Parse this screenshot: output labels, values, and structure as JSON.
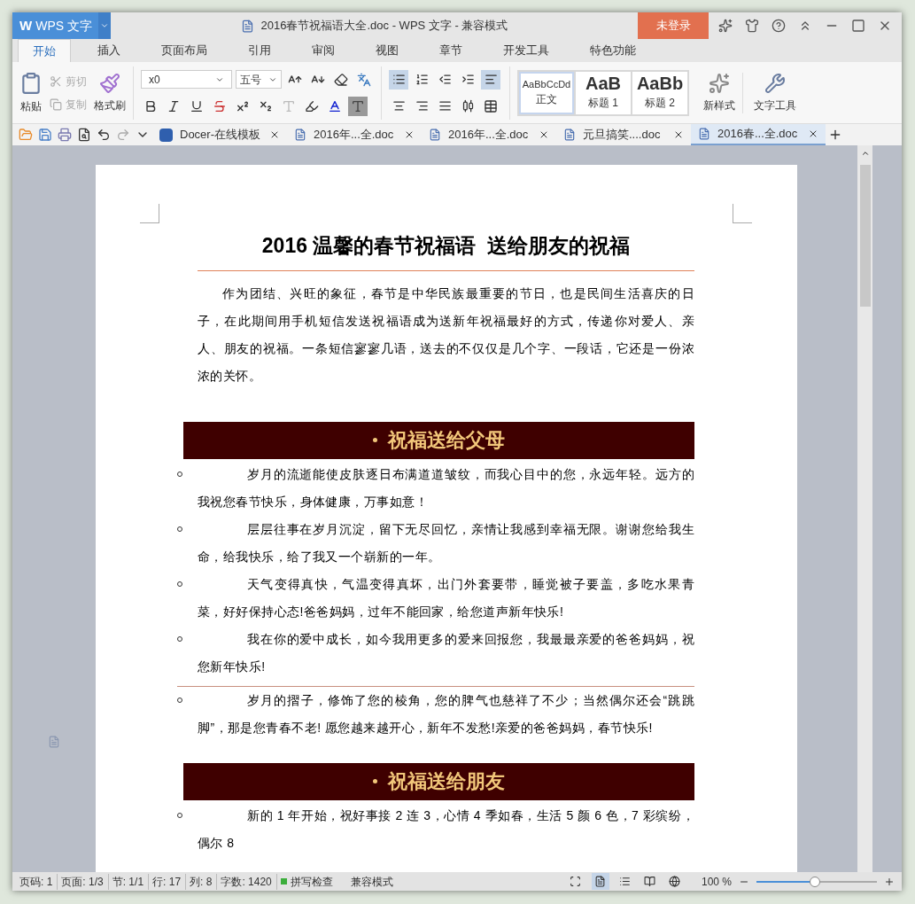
{
  "window": {
    "app_logo": "W",
    "app_button": "WPS 文字",
    "title": "2016春节祝福语大全.doc - WPS 文字 - 兼容模式",
    "login_button": "未登录"
  },
  "menu_tabs": [
    {
      "label": "开始",
      "selected": true
    },
    {
      "label": "插入",
      "selected": false
    },
    {
      "label": "页面布局",
      "selected": false
    },
    {
      "label": "引用",
      "selected": false
    },
    {
      "label": "审阅",
      "selected": false
    },
    {
      "label": "视图",
      "selected": false
    },
    {
      "label": "章节",
      "selected": false
    },
    {
      "label": "开发工具",
      "selected": false
    },
    {
      "label": "特色功能",
      "selected": false
    }
  ],
  "ribbon": {
    "paste": "粘贴",
    "cut": {
      "label": "剪切",
      "disabled": true
    },
    "copy": {
      "label": "复制",
      "disabled": true
    },
    "format_painter": "格式刷",
    "font_name": "x0",
    "font_size": "五号",
    "paragraph_tools": [
      {
        "kind": "bullets",
        "selected": true
      },
      {
        "kind": "numbering",
        "selected": false
      },
      {
        "kind": "outdent",
        "selected": false
      },
      {
        "kind": "indent",
        "selected": false
      },
      {
        "kind": "left",
        "selected": true
      },
      {
        "kind": "center",
        "selected": false
      },
      {
        "kind": "right",
        "selected": false
      },
      {
        "kind": "justify",
        "selected": false
      },
      {
        "kind": "distributed",
        "selected": false
      }
    ],
    "styles": [
      {
        "preview": "AaBbCcDd",
        "label": "正文",
        "selected": true
      },
      {
        "preview": "AaB",
        "label": "标题 1",
        "selected": false
      },
      {
        "preview": "AaBb",
        "label": "标题 2",
        "selected": false
      }
    ],
    "new_style": "新样式",
    "text_tools": "文字工具"
  },
  "doc_tabs": [
    {
      "label": "Docer-在线模板",
      "kind": "docer",
      "selected": false
    },
    {
      "label": "2016年...全.doc",
      "kind": "doc",
      "selected": false
    },
    {
      "label": "2016年...全.doc",
      "kind": "doc",
      "selected": false
    },
    {
      "label": "元旦搞笑....doc",
      "kind": "doc",
      "selected": false
    },
    {
      "label": "2016春...全.doc",
      "kind": "doc",
      "selected": true
    }
  ],
  "document": {
    "title": "2016 温馨的春节祝福语  送给朋友的祝福",
    "intro": "作为团结、兴旺的象征，春节是中华民族最重要的节日，也是民间生活喜庆的日子，在此期间用手机短信发送祝福语成为送新年祝福最好的方式，传递你对爱人、亲人、朋友的祝福。一条短信寥寥几语，送去的不仅仅是几个字、一段话，它还是一份浓浓的关怀。",
    "sections": [
      {
        "heading": "祝福送给父母",
        "items": [
          {
            "text": "岁月的流逝能使皮肤逐日布满道道皱纹，而我心目中的您，永远年轻。远方的我祝您春节快乐，身体健康，万事如意！",
            "divider_above": false
          },
          {
            "text": "层层往事在岁月沉淀，留下无尽回忆，亲情让我感到幸福无限。谢谢您给我生命，给我快乐，给了我又一个崭新的一年。",
            "divider_above": false
          },
          {
            "text": "天气变得真快，气温变得真坏，出门外套要带，睡觉被子要盖，多吃水果青菜，好好保持心态!爸爸妈妈，过年不能回家，给您道声新年快乐!",
            "divider_above": false
          },
          {
            "text": "我在你的爱中成长，如今我用更多的爱来回报您，我最最亲爱的爸爸妈妈，祝您新年快乐!",
            "divider_above": false
          },
          {
            "text": "岁月的摺子，修饰了您的棱角，您的脾气也慈祥了不少；当然偶尔还会“跳跳脚”，那是您青春不老! 愿您越来越开心，新年不发愁!亲爱的爸爸妈妈，春节快乐!",
            "divider_above": true
          }
        ]
      },
      {
        "heading": "祝福送给朋友",
        "items": [
          {
            "text": "新的 1 年开始，祝好事接 2 连 3，心情 4 季如春，生活 5 颜 6 色，7 彩缤纷，偶尔 8",
            "divider_above": false
          }
        ]
      }
    ]
  },
  "status_bar": {
    "items": [
      "页码: 1",
      "页面: 1/3",
      "节: 1/1",
      "行: 17",
      "列: 8",
      "字数: 1420"
    ],
    "spell_check": "拼写检查",
    "mode": "兼容模式",
    "views": [
      {
        "kind": "fullscreen",
        "selected": false
      },
      {
        "kind": "page",
        "selected": true
      },
      {
        "kind": "outline",
        "selected": false
      },
      {
        "kind": "reading",
        "selected": false
      },
      {
        "kind": "web",
        "selected": false
      }
    ],
    "zoom": "100 %",
    "zoom_slider": {
      "level": 0.48
    }
  }
}
